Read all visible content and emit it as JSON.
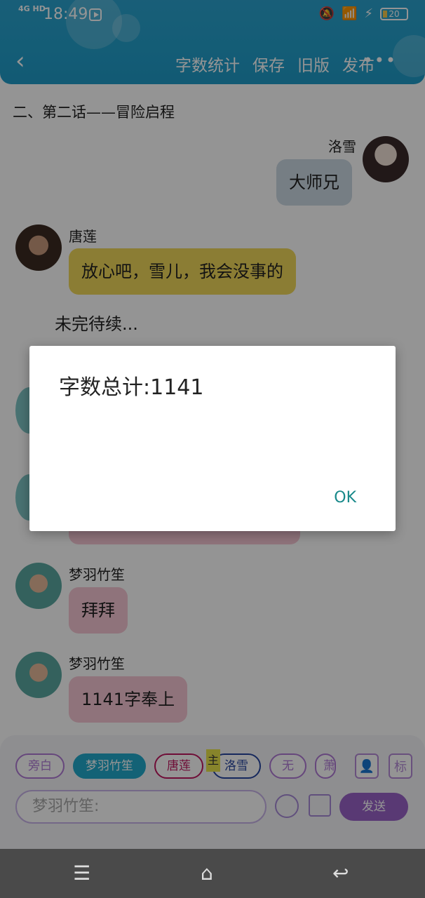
{
  "status_bar": {
    "network": "4G HD",
    "time": "18:49",
    "battery": "20"
  },
  "header": {
    "actions": [
      "字数统计",
      "保存",
      "旧版",
      "发布"
    ],
    "more": "•••"
  },
  "chapter_title": "二、第二话——冒险启程",
  "messages": [
    {
      "speaker": "洛雪",
      "text": "大师兄",
      "side": "right",
      "bubble_color": "#ccd9e4"
    },
    {
      "speaker": "唐莲",
      "text": "放心吧，雪儿，我会没事的",
      "side": "left",
      "bubble_color": "#f0d75a"
    },
    {
      "speaker": "梦羽竹笙",
      "text": "拜拜",
      "side": "left",
      "bubble_color": "#f6c6d4"
    },
    {
      "speaker": "梦羽竹笙",
      "text": "1141字奉上",
      "side": "left",
      "bubble_color": "#f6c6d4"
    }
  ],
  "to_be_continued": "未完待续...",
  "dialog": {
    "message": "字数总计:1141",
    "ok_label": "OK"
  },
  "input_panel": {
    "chips": [
      "旁白",
      "梦羽竹笙",
      "唐莲",
      "洛雪",
      "无",
      "萧"
    ],
    "main_tag": "主",
    "input_placeholder": "梦羽竹笙:",
    "send_label": "发送",
    "tag_button": "标"
  },
  "colors": {
    "header": "#23a0cc",
    "accent_purple": "#9a63c9",
    "ok_teal": "#18898a"
  }
}
